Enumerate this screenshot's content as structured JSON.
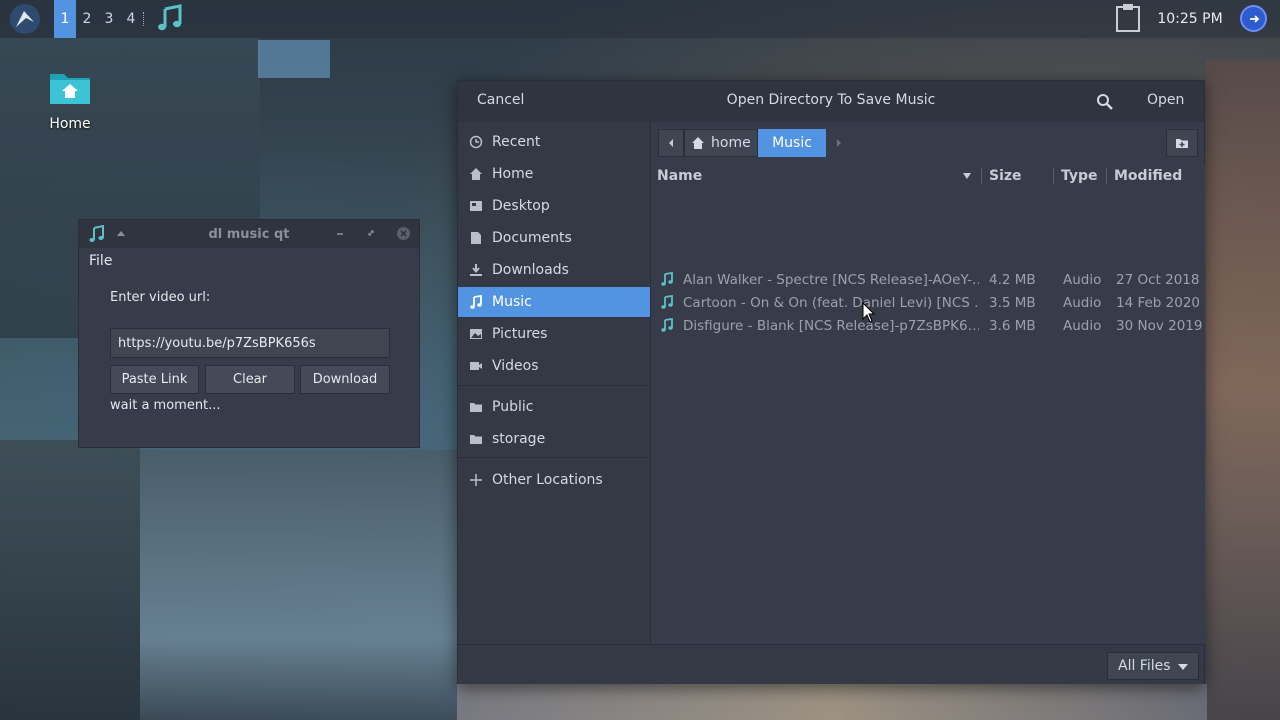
{
  "panel": {
    "workspaces": [
      "1",
      "2",
      "3",
      "4"
    ],
    "active_workspace": "1",
    "clock": "10:25 PM"
  },
  "desktop": {
    "home_icon_label": "Home"
  },
  "qt_window": {
    "title": "dl music qt",
    "menu_file": "File",
    "url_label": "Enter video url:",
    "url_value": "https://youtu.be/p7ZsBPK656s",
    "paste_button": "Paste Link",
    "clear_button": "Clear",
    "download_button": "Download",
    "status": "wait a moment..."
  },
  "file_chooser": {
    "cancel": "Cancel",
    "title": "Open Directory To Save Music",
    "open": "Open",
    "sidebar": [
      "Recent",
      "Home",
      "Desktop",
      "Documents",
      "Downloads",
      "Music",
      "Pictures",
      "Videos",
      "Public",
      "storage",
      "Other Locations"
    ],
    "selected_place": "Music",
    "path": [
      "home",
      "Music"
    ],
    "columns": {
      "name": "Name",
      "size": "Size",
      "type": "Type",
      "modified": "Modified"
    },
    "files": [
      {
        "name": "Alan Walker - Spectre [NCS Release]-AOeY-…",
        "size": "4.2 MB",
        "type": "Audio",
        "modified": "27 Oct 2018"
      },
      {
        "name": "Cartoon - On & On (feat. Daniel Levi) [NCS …",
        "size": "3.5 MB",
        "type": "Audio",
        "modified": "14 Feb 2020"
      },
      {
        "name": "Disfigure - Blank [NCS Release]-p7ZsBPK6…",
        "size": "3.6 MB",
        "type": "Audio",
        "modified": "30 Nov 2019"
      }
    ],
    "filter": "All Files"
  },
  "colors": {
    "accent": "#5294e2",
    "window_bg": "#383c4a",
    "header_bg": "#2f343f",
    "music_icon": "#5bc0c8"
  }
}
